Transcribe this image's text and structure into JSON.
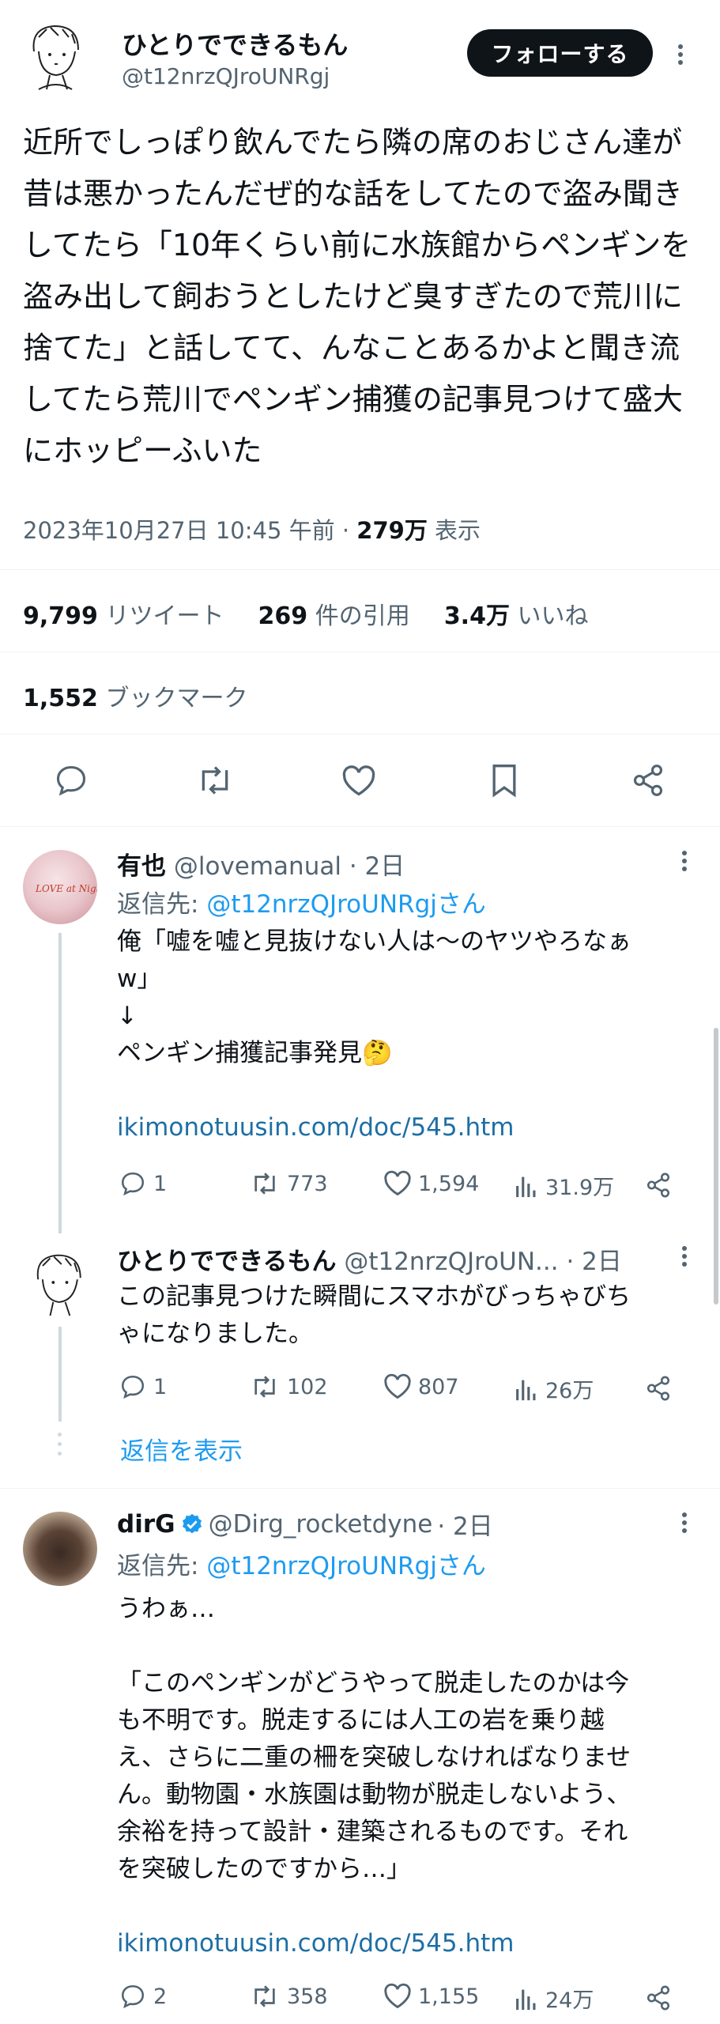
{
  "tweet": {
    "display_name": "ひとりでできるもん",
    "handle": "@t12nrzQJroUNRgj",
    "follow_label": "フォローする",
    "text": "近所でしっぽり飲んでたら隣の席のおじさん達が昔は悪かったんだぜ的な話をしてたので盗み聞きしてたら「10年くらい前に水族館からペンギンを盗み出して飼おうとしたけど臭すぎたので荒川に捨てた」と話してて、んなことあるかよと聞き流してたら荒川でペンギン捕獲の記事見つけて盛大にホッピーふいた",
    "timestamp": "2023年10月27日 10:45 午前",
    "separator": " · ",
    "views": "279万",
    "views_label": " 表示",
    "retweets": "9,799",
    "retweets_label": " リツイート",
    "quotes": "269",
    "quotes_label": " 件の引用",
    "likes": "3.4万",
    "likes_label": " いいね",
    "bookmarks": "1,552",
    "bookmarks_label": " ブックマーク"
  },
  "replies": [
    {
      "name": "有也",
      "handle": "@lovemanual",
      "time": " · 2日",
      "reply_to_prefix": "返信先: ",
      "reply_to": "@t12nrzQJroUNRgjさん",
      "lines": [
        "俺「嘘を嘘と見抜けない人は〜のヤツやろなぁ",
        "w」",
        "↓",
        "ペンギン捕獲記事発見🤔",
        "",
        "ikimonotuusin.com/doc/545.htm"
      ],
      "comments": "1",
      "retweets": "773",
      "likes": "1,594",
      "views": "31.9万",
      "avatar_text": "LOVE at Night"
    },
    {
      "name": "ひとりでできるもん",
      "handle": "@t12nrzQJroUN...",
      "time": " · 2日",
      "lines": [
        "この記事見つけた瞬間にスマホがびっちゃびち",
        "ゃになりました。"
      ],
      "comments": "1",
      "retweets": "102",
      "likes": "807",
      "views": "26万"
    },
    {
      "name": "dirG",
      "handle": "@Dirg_rocketdyne",
      "time": " · 2日",
      "reply_to_prefix": "返信先: ",
      "reply_to": "@t12nrzQJroUNRgjさん",
      "lines": [
        "うわぁ…",
        "",
        "「このペンギンがどうやって脱走したのかは今",
        "も不明です。脱走するには人工の岩を乗り越",
        "え、さらに二重の柵を突破しなければなりませ",
        "ん。動物園・水族園は動物が脱走しないよう、",
        "余裕を持って設計・建築されるものです。それ",
        "を突破したのですから…」",
        "",
        "ikimonotuusin.com/doc/545.htm"
      ],
      "comments": "2",
      "retweets": "358",
      "likes": "1,155",
      "views": "24万"
    }
  ],
  "show_replies_label": "返信を表示",
  "colors": {
    "accent": "#1d9bf0",
    "text": "#0f1419",
    "muted": "#536471",
    "verified": "#1d9bf0"
  }
}
